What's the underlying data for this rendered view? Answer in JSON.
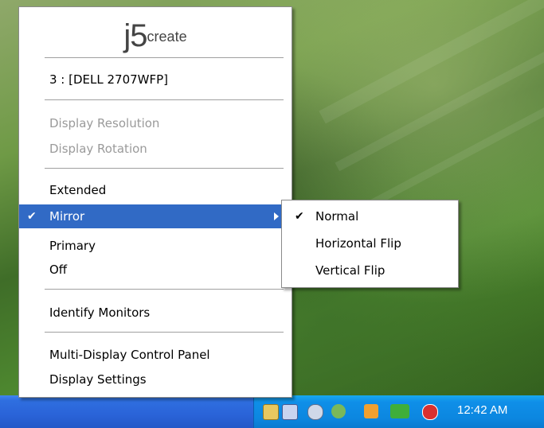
{
  "menu": {
    "logo_main": "j5",
    "logo_sub": "create",
    "monitor": "3 : [DELL 2707WFP]",
    "display_resolution": "Display Resolution",
    "display_rotation": "Display Rotation",
    "extended": "Extended",
    "mirror": "Mirror",
    "primary": "Primary",
    "off": "Off",
    "identify_monitors": "Identify Monitors",
    "control_panel": "Multi-Display Control Panel",
    "display_settings": "Display Settings",
    "check_glyph": "✔"
  },
  "submenu": {
    "normal": "Normal",
    "horizontal_flip": "Horizontal Flip",
    "vertical_flip": "Vertical Flip"
  },
  "taskbar": {
    "clock": "12:42 AM"
  },
  "colors": {
    "highlight": "#316ac5",
    "taskbar": "#2a63d8",
    "tray": "#0f8fe8"
  }
}
